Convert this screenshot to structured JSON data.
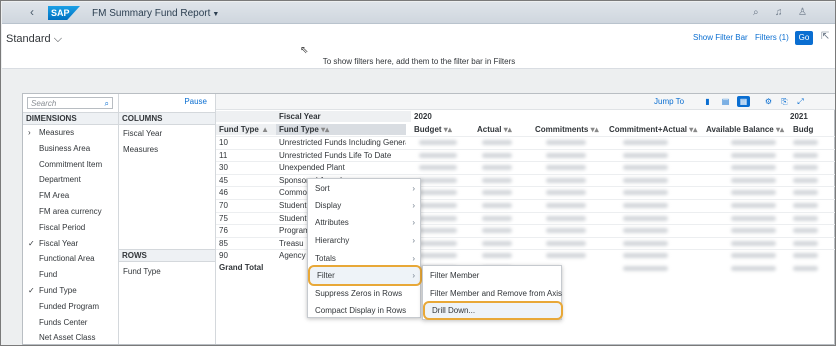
{
  "shell": {
    "title": "FM Summary Fund Report"
  },
  "header": {
    "variant": "Standard",
    "show_filter_bar": "Show Filter Bar",
    "filters": "Filters (1)",
    "go": "Go",
    "hint": "To show filters here, add them to the filter bar in Filters"
  },
  "dims": {
    "search_placeholder": "Search",
    "title": "DIMENSIONS",
    "items": [
      {
        "label": "Measures",
        "mark": "›"
      },
      {
        "label": "Business Area",
        "mark": ""
      },
      {
        "label": "Commitment Item",
        "mark": ""
      },
      {
        "label": "Department",
        "mark": ""
      },
      {
        "label": "FM Area",
        "mark": ""
      },
      {
        "label": "FM area currency",
        "mark": ""
      },
      {
        "label": "Fiscal Period",
        "mark": ""
      },
      {
        "label": "Fiscal Year",
        "mark": "✓"
      },
      {
        "label": "Functional Area",
        "mark": ""
      },
      {
        "label": "Fund",
        "mark": ""
      },
      {
        "label": "Fund Type",
        "mark": "✓"
      },
      {
        "label": "Funded Program",
        "mark": ""
      },
      {
        "label": "Funds Center",
        "mark": ""
      },
      {
        "label": "Net Asset Class",
        "mark": ""
      }
    ]
  },
  "layout": {
    "pause": "Pause",
    "columns_title": "COLUMNS",
    "columns": [
      "Fiscal Year",
      "Measures"
    ],
    "rows_title": "ROWS",
    "rows": [
      "Fund Type"
    ]
  },
  "grid": {
    "jump_to": "Jump To",
    "fiscal_year_label": "Fiscal Year",
    "year1": "2020",
    "year2": "2021",
    "headers": {
      "fund_type": "Fund Type",
      "fund_type_text": "Fund Type",
      "budget": "Budget",
      "actual": "Actual",
      "commitments": "Commitments",
      "commit_actual": "Commitment+Actual",
      "available": "Available Balance",
      "budg2": "Budg"
    },
    "rows": [
      {
        "code": "10",
        "name": "Unrestricted Funds Including Genera"
      },
      {
        "code": "11",
        "name": "Unrestricted Funds Life To Date"
      },
      {
        "code": "30",
        "name": "Unexpended Plant"
      },
      {
        "code": "45",
        "name": "Sponsored Awards"
      },
      {
        "code": "46",
        "name": "Commo"
      },
      {
        "code": "70",
        "name": "Student"
      },
      {
        "code": "75",
        "name": "Student"
      },
      {
        "code": "76",
        "name": "Program"
      },
      {
        "code": "85",
        "name": "Treasu"
      },
      {
        "code": "90",
        "name": "Agency"
      }
    ],
    "grand_total": "Grand Total"
  },
  "context_menu": {
    "items": [
      "Sort",
      "Display",
      "Attributes",
      "Hierarchy",
      "Totals",
      "Filter",
      "Suppress Zeros in Rows",
      "Compact Display in Rows"
    ]
  },
  "sub_menu": {
    "items": [
      "Filter Member",
      "Filter Member and Remove from Axis",
      "Drill Down..."
    ]
  },
  "colors": {
    "accent": "#0a6ed1",
    "highlight": "#e8a838"
  }
}
